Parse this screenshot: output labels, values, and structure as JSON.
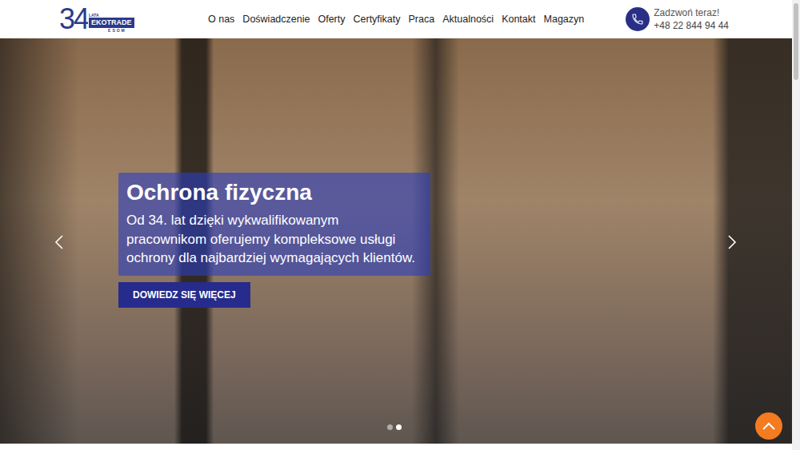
{
  "logo": {
    "number": "34",
    "years": "LATA",
    "brand": "EKOTRADE",
    "sub": "ESOM"
  },
  "nav": [
    "O nas",
    "Doświadczenie",
    "Oferty",
    "Certyfikaty",
    "Praca",
    "Aktualności",
    "Kontakt",
    "Magazyn"
  ],
  "contact": {
    "label": "Zadzwoń teraz!",
    "phone": "+48 22 844 94 44"
  },
  "slider": {
    "title": "Ochrona fizyczna",
    "text": "Od 34. lat dzięki wykwalifikowanym pracownikom oferujemy kompleksowe usługi ochrony dla najbardziej wymagających klientów.",
    "button": "DOWIEDZ SIĘ WIĘCEJ",
    "dots": [
      {
        "selected": false
      },
      {
        "selected": true
      }
    ]
  }
}
